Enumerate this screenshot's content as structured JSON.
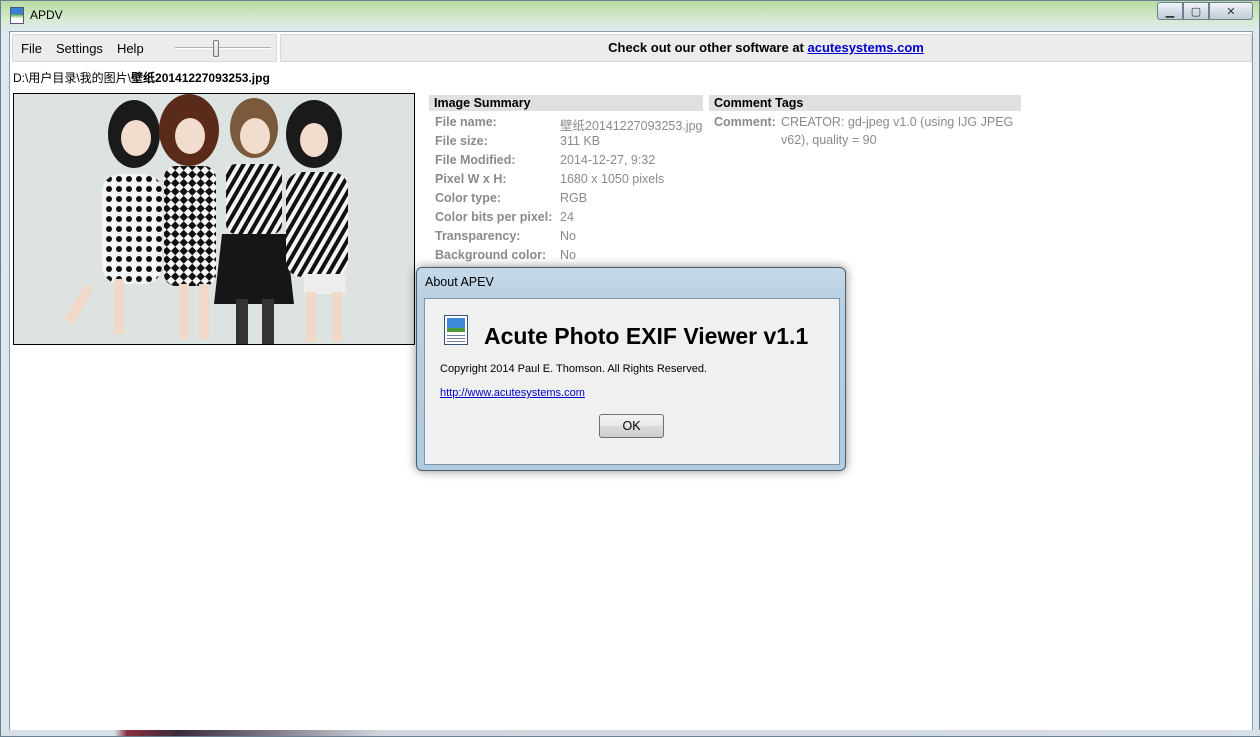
{
  "window": {
    "title": "APDV",
    "controls": {
      "minimize": "▁",
      "maximize": "▢",
      "close": "✕"
    }
  },
  "menu": {
    "items": [
      "File",
      "Settings",
      "Help"
    ],
    "zoom_slider_level": 0.42
  },
  "promo": {
    "text": "Check out our other software at ",
    "link": "acutesystems.com"
  },
  "file_path": {
    "directory": "D:\\用户目录\\我的图片\\",
    "filename": "壁纸20141227093253.jpg"
  },
  "image_summary": {
    "header": "Image Summary",
    "rows": [
      {
        "key": "File name:",
        "value": "壁纸20141227093253.jpg"
      },
      {
        "key": "File size:",
        "value": "311 KB"
      },
      {
        "key": "File Modified:",
        "value": "2014-12-27, 9:32"
      },
      {
        "key": "Pixel W x H:",
        "value": "1680 x 1050 pixels"
      },
      {
        "key": "Color type:",
        "value": "RGB"
      },
      {
        "key": "Color bits per pixel:",
        "value": "24"
      },
      {
        "key": "Transparency:",
        "value": "No"
      },
      {
        "key": "Background color:",
        "value": "No"
      }
    ]
  },
  "comment_tags": {
    "header": "Comment Tags",
    "key": "Comment:",
    "value_line1": "CREATOR: gd-jpeg v1.0 (using IJG JPEG",
    "value_line2": "v62), quality = 90"
  },
  "about_dialog": {
    "title": "About APEV",
    "heading": "Acute Photo EXIF Viewer v1.1",
    "copyright": "Copyright 2014 Paul E. Thomson. All Rights Reserved.",
    "link": "http://www.acutesystems.com",
    "ok_label": "OK",
    "icon": "document-image-icon"
  }
}
